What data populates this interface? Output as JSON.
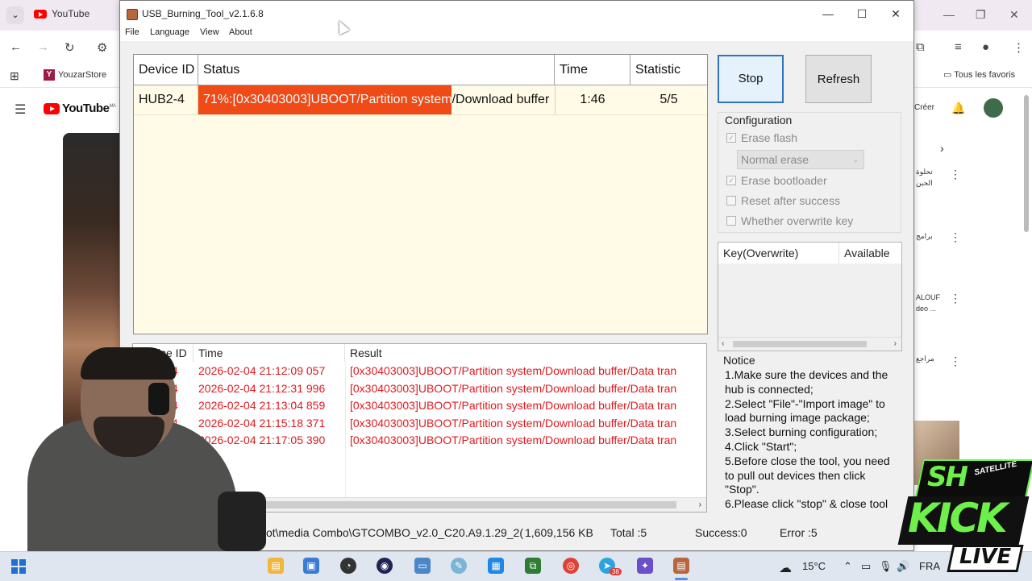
{
  "browser": {
    "tab_title": "YouTube",
    "bookmark_1": "YouzarStore",
    "tous_les_favoris": "Tous les favoris",
    "yt_brand": "YouTube",
    "yt_brand_sup": "MA",
    "creer": "Créer",
    "right_items": [
      "تحلوة",
      "برامج",
      "ALOUF",
      "مراجع"
    ],
    "right_items_sub": [
      "الحبن",
      "",
      "deo ...",
      ""
    ]
  },
  "window": {
    "title": "USB_Burning_Tool_v2.1.6.8",
    "menu": [
      "File",
      "Language",
      "View",
      "About"
    ]
  },
  "device_grid": {
    "columns": [
      "Device ID",
      "Status",
      "Time",
      "Statistic"
    ],
    "rows": [
      {
        "device_id": "HUB2-4",
        "status": "71%:[0x30403003]UBOOT/Partition system/Download buffer",
        "progress": 0.71,
        "time": "1:46",
        "statistic": "5/5"
      }
    ]
  },
  "buttons": {
    "stop": "Stop",
    "refresh": "Refresh"
  },
  "configuration": {
    "title": "Configuration",
    "erase_flash": "Erase flash",
    "erase_flash_checked": true,
    "erase_mode": "Normal erase",
    "erase_bootloader": "Erase bootloader",
    "erase_bootloader_checked": true,
    "reset_after_success": "Reset after success",
    "reset_after_success_checked": false,
    "overwrite_key": "Whether overwrite key",
    "overwrite_key_checked": false
  },
  "key_list": {
    "columns": [
      "Key(Overwrite)",
      "Available"
    ]
  },
  "notice": {
    "title": "Notice",
    "lines": [
      "1.Make sure the devices and the",
      "hub is connected;",
      "2.Select \"File\"-\"Import image\" to",
      "load burning image package;",
      "3.Select burning configuration;",
      "4.Click \"Start\";",
      "5.Before close the tool, you need",
      "to pull out devices then click",
      "\"Stop\".",
      "6.Please click \"stop\" & close tool"
    ]
  },
  "log": {
    "columns": [
      "Device ID",
      "Time",
      "Result"
    ],
    "rows": [
      {
        "device_id": "HUB2-4",
        "time": "2026-02-04 21:12:09 057",
        "result": "[0x30403003]UBOOT/Partition system/Download buffer/Data tran"
      },
      {
        "device_id": "HUB2-4",
        "time": "2026-02-04 21:12:31 996",
        "result": "[0x30403003]UBOOT/Partition system/Download buffer/Data tran"
      },
      {
        "device_id": "HUB2-4",
        "time": "2026-02-04 21:13:04 859",
        "result": "[0x30403003]UBOOT/Partition system/Download buffer/Data tran"
      },
      {
        "device_id": "HUB2-4",
        "time": "2026-02-04 21:15:18 371",
        "result": "[0x30403003]UBOOT/Partition system/Download buffer/Data tran"
      },
      {
        "device_id": "HUB2-4",
        "time": "2026-02-04 21:17:05 390",
        "result": "[0x30403003]UBOOT/Partition system/Download buffer/Data tran"
      }
    ],
    "text_color": "#e0191f"
  },
  "statusbar": {
    "image_path": "oot\\media Combo\\GTCOMBO_v2.0_C20.A9.1.29_2(",
    "size": "1,609,156 KB",
    "total": "Total :5",
    "success": "Success:0",
    "error": "Error :5"
  },
  "taskbar": {
    "weather": "15°C",
    "lang": "FRA",
    "badge": "38"
  },
  "overlay": {
    "logo_sat": "SH",
    "logo_sat_sub": "SATELLITE",
    "logo_main": "KICK",
    "logo_live": "LIVE"
  },
  "colors": {
    "progress_fill": "#f04b16",
    "grid_bg": "#fffbe6",
    "accent": "#2e73c8",
    "kick_green": "#6df04a"
  }
}
